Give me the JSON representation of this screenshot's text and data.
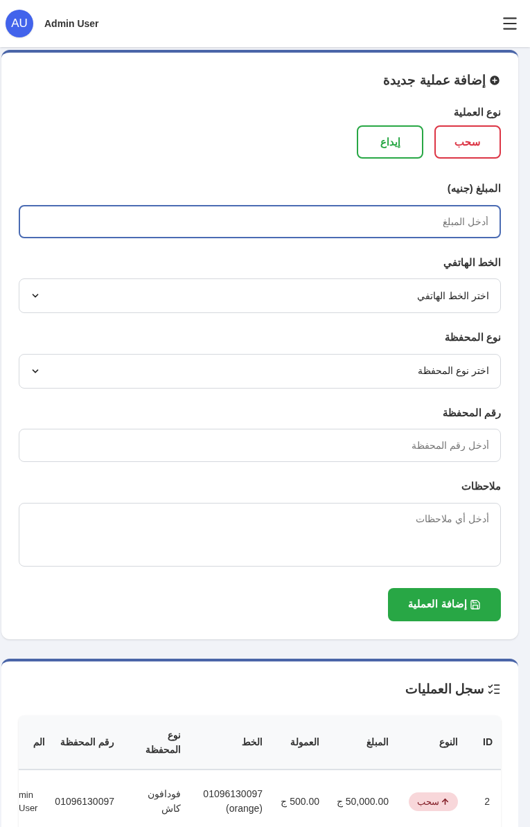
{
  "header": {
    "avatar": "AU",
    "user_name": "Admin User"
  },
  "form": {
    "title": "إضافة عملية جديدة",
    "type_label": "نوع العملية",
    "types": [
      {
        "label": "سحب",
        "kind": "withdraw",
        "selected": false
      },
      {
        "label": "إيداع",
        "kind": "deposit",
        "selected": false
      }
    ],
    "fields": [
      {
        "kind": "input",
        "label": "المبلغ (جنيه)",
        "placeholder": "أدخل المبلغ",
        "focused": true
      },
      {
        "kind": "select",
        "label": "الخط الهاتفي",
        "value": "اختر الخط الهاتفي"
      },
      {
        "kind": "select",
        "label": "نوع المحفظة",
        "value": "اختر نوع المحفظة"
      },
      {
        "kind": "input",
        "label": "رقم المحفظة",
        "placeholder": "أدخل رقم المحفظة",
        "focused": false
      },
      {
        "kind": "textarea",
        "label": "ملاحظات",
        "placeholder": "أدخل أي ملاحظات"
      }
    ],
    "submit": "إضافة العملية"
  },
  "history": {
    "title": "سجل العمليات",
    "table": {
      "columns": [
        "ID",
        "النوع",
        "المبلغ",
        "العمولة",
        "الخط",
        "نوع المحفظة",
        "رقم المحفظة",
        "الم"
      ],
      "rows": [
        {
          "id": "2",
          "type": {
            "label": "سحب",
            "kind": "withdraw"
          },
          "amount": "50,000.00 ج",
          "commission": "500.00 ج",
          "line": "01096130097 (orange)",
          "wallet_type": "فودافون كاش",
          "wallet_number": "01096130097",
          "column_8": "min User"
        }
      ]
    }
  }
}
